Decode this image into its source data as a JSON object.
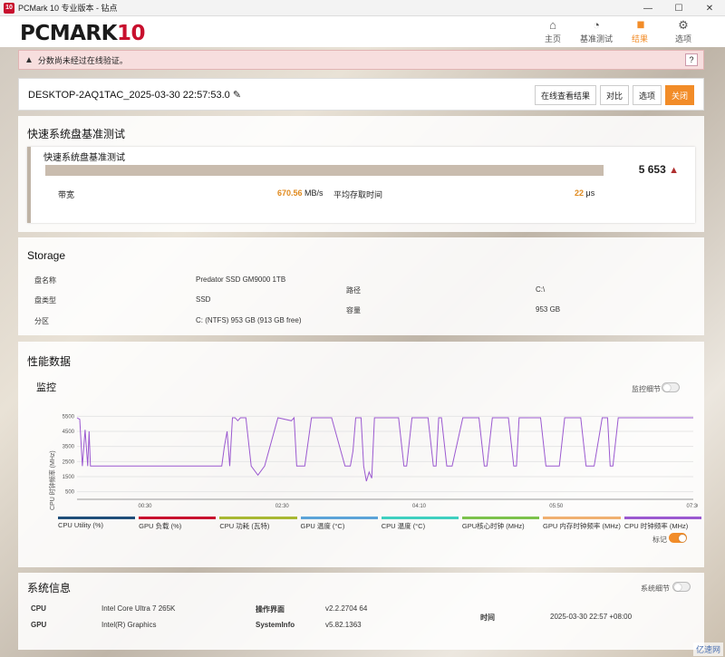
{
  "window": {
    "title": "PCMark 10 专业版本 - 钻点",
    "logo_text": "10",
    "controls": [
      "—",
      "☐",
      "✕"
    ]
  },
  "brand": {
    "name": "PCMARK",
    "version": "10"
  },
  "nav": [
    {
      "label": "主页",
      "icon": "home-icon",
      "glyph": "⌂"
    },
    {
      "label": "基准测试",
      "icon": "gauge-icon",
      "glyph": "◔"
    },
    {
      "label": "结果",
      "icon": "bar-chart-icon",
      "glyph": "▮▮"
    },
    {
      "label": "选项",
      "icon": "gear-icon",
      "glyph": "⚙"
    }
  ],
  "warning": {
    "text": "分数尚未经过在线验证。",
    "help": "?"
  },
  "result": {
    "title": "DESKTOP-2AQ1TAC_2025-03-30 22:57:53.0",
    "buttons": {
      "online": "在线查看结果",
      "compare": "对比",
      "options": "选项",
      "close": "关闭"
    }
  },
  "quick_test": {
    "section_title": "快速系统盘基准测试",
    "test_name": "快速系统盘基准测试",
    "score": "5 653",
    "bandwidth_label": "带宽",
    "bandwidth_value": "670.56",
    "bandwidth_unit": "MB/s",
    "latency_label": "平均存取时间",
    "latency_value": "22",
    "latency_unit": "μs"
  },
  "storage": {
    "title": "Storage",
    "disk_name_label": "盘名称",
    "disk_name": "Predator SSD GM9000 1TB",
    "disk_type_label": "盘类型",
    "disk_type": "SSD",
    "partition_label": "分区",
    "partition": "C: (NTFS) 953 GB (913 GB free)",
    "path_label": "路径",
    "path": "C:\\",
    "capacity_label": "容量",
    "capacity": "953 GB"
  },
  "perf": {
    "title": "性能数据",
    "monitor_title": "监控",
    "monitor_detail_label": "监控细节",
    "ylabel": "CPU 时钟频率 (MHz)",
    "yticks": [
      "5500",
      "4500",
      "3500",
      "2500",
      "1500",
      "500"
    ],
    "xticks": [
      "00:30",
      "02:30",
      "04:10",
      "05:50",
      "07:30"
    ],
    "mark_label": "标记",
    "legend": [
      {
        "name": "CPU Utility (%)",
        "color": "#1f4e79"
      },
      {
        "name": "GPU 负载 (%)",
        "color": "#c8102e"
      },
      {
        "name": "CPU 功耗 (瓦特)",
        "color": "#a8b832"
      },
      {
        "name": "GPU 温度 (°C)",
        "color": "#5ba4d8"
      },
      {
        "name": "CPU 温度 (°C)",
        "color": "#3fd0c0"
      },
      {
        "name": "GPU核心时钟 (MHz)",
        "color": "#7cc24c"
      },
      {
        "name": "GPU 内存时钟频率 (MHz)",
        "color": "#f0b070"
      },
      {
        "name": "CPU 时钟频率 (MHz)",
        "color": "#9b59d0"
      }
    ]
  },
  "chart_data": {
    "type": "line",
    "title": "",
    "xlabel": "",
    "ylabel": "CPU 时钟频率 (MHz)",
    "ylim": [
      0,
      6000
    ],
    "xlim": [
      0,
      460
    ],
    "series": [
      {
        "name": "CPU 时钟频率 (MHz)",
        "x": [
          0,
          2,
          4,
          6,
          8,
          9,
          10,
          12,
          14,
          16,
          18,
          20,
          22,
          24,
          26,
          28,
          30,
          32,
          36,
          40,
          46,
          60,
          80,
          100,
          108,
          110,
          112,
          114,
          116,
          118,
          120,
          122,
          124,
          126,
          130,
          135,
          140,
          150,
          160,
          162,
          164,
          166,
          170,
          175,
          180,
          190,
          200,
          204,
          206,
          208,
          212,
          214,
          216,
          218,
          220,
          222,
          228,
          240,
          244,
          246,
          250,
          254,
          258,
          262,
          266,
          268,
          270,
          272,
          276,
          280,
          288,
          292,
          300,
          304,
          306,
          310,
          314,
          318,
          322,
          326,
          328,
          330,
          334,
          338,
          346,
          350,
          360,
          364,
          370,
          376,
          380,
          386,
          392,
          396,
          398,
          400,
          404,
          408,
          414,
          420,
          430,
          440,
          450,
          460
        ],
        "y": [
          5400,
          5300,
          2200,
          4600,
          2200,
          4500,
          2200,
          2200,
          2200,
          2200,
          2200,
          2200,
          2200,
          2200,
          2200,
          2200,
          2200,
          2200,
          2200,
          2200,
          2200,
          2200,
          2200,
          2200,
          2200,
          3500,
          4500,
          2200,
          5400,
          5400,
          5200,
          5400,
          5400,
          5400,
          2200,
          1600,
          2200,
          5400,
          5200,
          5400,
          2200,
          2200,
          2200,
          5400,
          5400,
          5400,
          2200,
          2200,
          3200,
          5400,
          5400,
          2200,
          1200,
          1800,
          1400,
          5400,
          5400,
          5400,
          2200,
          2200,
          5400,
          5400,
          5400,
          5400,
          2200,
          2200,
          5400,
          5400,
          2200,
          2200,
          5400,
          5400,
          5400,
          2200,
          2200,
          5400,
          5400,
          5400,
          5400,
          2200,
          2200,
          5400,
          5400,
          5400,
          5400,
          2200,
          2200,
          5400,
          5400,
          5400,
          2200,
          2200,
          5400,
          5400,
          2200,
          2200,
          5400,
          5400,
          5400,
          5400,
          5400,
          5400,
          5400,
          5400
        ],
        "color": "#9b59d0"
      }
    ]
  },
  "sysinfo": {
    "title": "系统信息",
    "detail_label": "系统细节",
    "cpu_label": "CPU",
    "cpu": "Intel Core Ultra 7 265K",
    "gpu_label": "GPU",
    "gpu": "Intel(R) Graphics",
    "os_label": "操作界面",
    "os": "v2.2.2704 64",
    "sysinfo_label": "SystemInfo",
    "sysinfo_ver": "v5.82.1363",
    "time_label": "时间",
    "time": "2025-03-30 22:57 +08:00"
  },
  "watermark": "亿速网"
}
